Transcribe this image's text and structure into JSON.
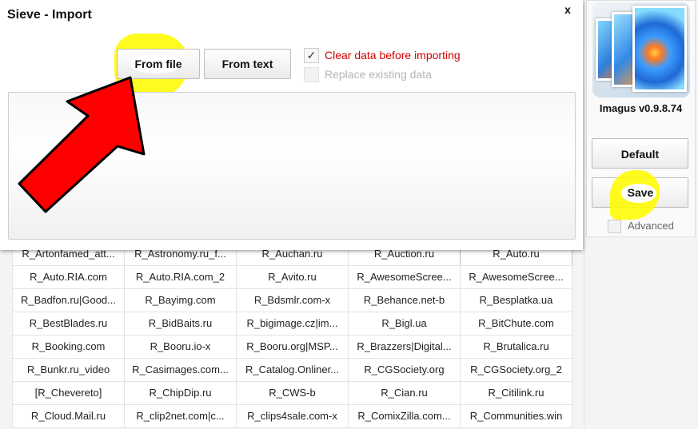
{
  "dialog": {
    "title": "Sieve - Import",
    "close_label": "x",
    "from_file_label": "From file",
    "from_text_label": "From text",
    "clear_data_label": "Clear data before importing",
    "clear_data_checked": true,
    "replace_existing_label": "Replace existing data",
    "replace_existing_checked": false
  },
  "side_panel": {
    "version": "Imagus v0.9.8.74",
    "default_label": "Default",
    "save_label": "Save",
    "advanced_label": "Advanced",
    "advanced_checked": false
  },
  "sieve_rows": [
    [
      "R_Artonfamed_att...",
      "R_Astronomy.ru_f...",
      "R_Auchan.ru",
      "R_Auction.ru",
      "R_Auto.ru"
    ],
    [
      "R_Auto.RIA.com",
      "R_Auto.RIA.com_2",
      "R_Avito.ru",
      "R_AwesomeScree...",
      "R_AwesomeScree..."
    ],
    [
      "R_Badfon.ru|Good...",
      "R_Bayimg.com",
      "R_Bdsmlr.com-x",
      "R_Behance.net-b",
      "R_Besplatka.ua"
    ],
    [
      "R_BestBlades.ru",
      "R_BidBaits.ru",
      "R_bigimage.cz|im...",
      "R_Bigl.ua",
      "R_BitChute.com"
    ],
    [
      "R_Booking.com",
      "R_Booru.io-x",
      "R_Booru.org|MSP...",
      "R_Brazzers|Digital...",
      "R_Brutalica.ru"
    ],
    [
      "R_Bunkr.ru_video",
      "R_Casimages.com...",
      "R_Catalog.Onliner...",
      "R_CGSociety.org",
      "R_CGSociety.org_2"
    ],
    [
      "[R_Chevereto]",
      "R_ChipDip.ru",
      "R_CWS-b",
      "R_Cian.ru",
      "R_Citilink.ru"
    ],
    [
      "R_Cloud.Mail.ru",
      "R_clip2net.com|c...",
      "R_clips4sale.com-x",
      "R_ComixZilla.com...",
      "R_Communities.win"
    ]
  ],
  "colors": {
    "highlight": "#fff500",
    "arrow_fill": "#ff0000",
    "clear_label": "#d00000"
  }
}
